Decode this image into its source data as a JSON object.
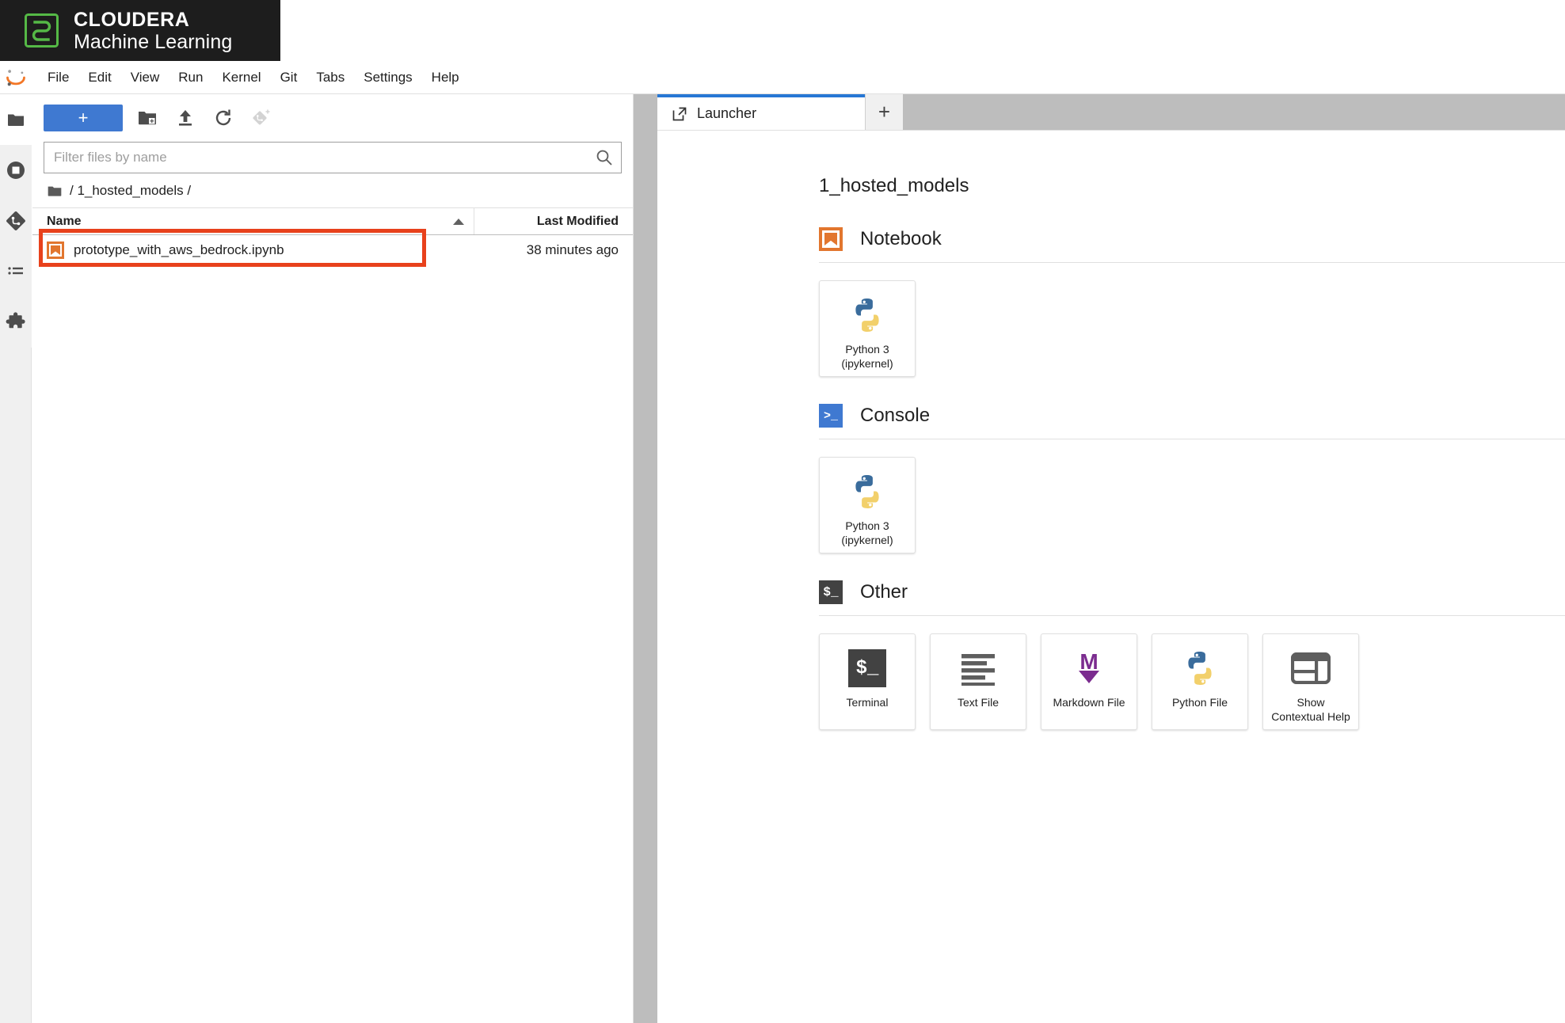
{
  "brand": {
    "line1": "CLOUDERA",
    "line2": "Machine Learning",
    "logo_icon": "cloudera-logo-icon",
    "bg_color": "#1d1d1d"
  },
  "menubar": {
    "logo_icon": "jupyter-logo-icon",
    "items": [
      {
        "label": "File"
      },
      {
        "label": "Edit"
      },
      {
        "label": "View"
      },
      {
        "label": "Run"
      },
      {
        "label": "Kernel"
      },
      {
        "label": "Git"
      },
      {
        "label": "Tabs"
      },
      {
        "label": "Settings"
      },
      {
        "label": "Help"
      }
    ]
  },
  "activity_bar": {
    "items": [
      {
        "icon": "folder-icon",
        "name": "file-browser",
        "selected": true
      },
      {
        "icon": "stop-circle-icon",
        "name": "running-kernels",
        "selected": false
      },
      {
        "icon": "git-icon",
        "name": "git-panel",
        "selected": false
      },
      {
        "icon": "list-icon",
        "name": "table-of-contents",
        "selected": false
      },
      {
        "icon": "puzzle-icon",
        "name": "extension-manager",
        "selected": false
      }
    ]
  },
  "file_browser": {
    "toolbar": {
      "new_label": "+",
      "new_folder_icon": "new-folder-icon",
      "upload_icon": "upload-icon",
      "refresh_icon": "refresh-icon",
      "git_clone_icon": "git-clone-icon"
    },
    "filter": {
      "placeholder": "Filter files by name",
      "value": "",
      "search_icon": "search-icon"
    },
    "breadcrumb": {
      "home_icon": "folder-icon",
      "text": "/ 1_hosted_models /"
    },
    "columns": {
      "name": "Name",
      "last_modified": "Last Modified",
      "sort_direction": "ascending"
    },
    "rows": [
      {
        "icon": "notebook-icon",
        "name": "prototype_with_aws_bedrock.ipynb",
        "last_modified": "38 minutes ago",
        "highlighted": true
      }
    ],
    "highlight_color": "#e8411c"
  },
  "tab_bar": {
    "tabs": [
      {
        "label": "Launcher",
        "icon": "launcher-icon",
        "active": true
      }
    ],
    "add_tab_label": "+",
    "active_indicator_color": "#2677d4"
  },
  "launcher": {
    "title": "1_hosted_models",
    "sections": [
      {
        "name": "notebook",
        "label": "Notebook",
        "icon": "notebook-icon",
        "cards": [
          {
            "label": "Python 3\n(ipykernel)",
            "label_line1": "Python 3",
            "label_line2": "(ipykernel)",
            "icon": "python-icon"
          }
        ]
      },
      {
        "name": "console",
        "label": "Console",
        "icon": "console-icon",
        "cards": [
          {
            "label": "Python 3\n(ipykernel)",
            "label_line1": "Python 3",
            "label_line2": "(ipykernel)",
            "icon": "python-icon"
          }
        ]
      },
      {
        "name": "other",
        "label": "Other",
        "icon": "terminal-icon",
        "cards": [
          {
            "label_line1": "Terminal",
            "label_line2": "",
            "icon": "terminal-icon"
          },
          {
            "label_line1": "Text File",
            "label_line2": "",
            "icon": "text-file-icon"
          },
          {
            "label_line1": "Markdown File",
            "label_line2": "",
            "icon": "markdown-icon"
          },
          {
            "label_line1": "Python File",
            "label_line2": "",
            "icon": "python-icon"
          },
          {
            "label_line1": "Show",
            "label_line2": "Contextual Help",
            "icon": "contextual-help-icon"
          }
        ]
      }
    ]
  },
  "colors": {
    "accent_blue": "#3f79d1",
    "tab_blue": "#2677d4",
    "cloudera_green": "#55b946",
    "jupyter_orange": "#f37726",
    "notebook_orange": "#e2762e",
    "markdown_purple": "#7b2c8f",
    "python_blue": "#3a6c9c",
    "python_yellow": "#f2d06b",
    "tabbar_grey": "#bdbdbd"
  }
}
